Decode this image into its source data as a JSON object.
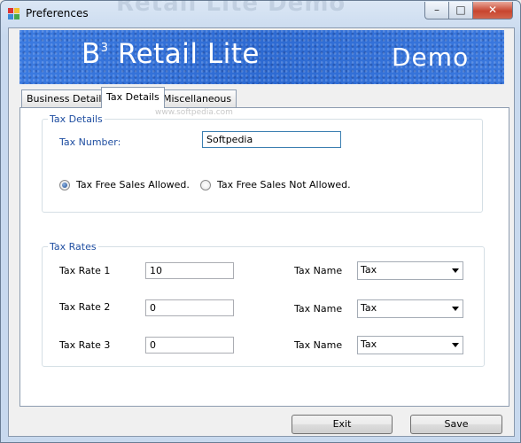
{
  "window": {
    "title": "Preferences",
    "faded_title": "Retail Lite Demo"
  },
  "banner": {
    "title": "B",
    "superscript": "3",
    "title_rest": " Retail Lite",
    "edition": "Demo"
  },
  "tabs": [
    {
      "label": "Business Details",
      "active": false
    },
    {
      "label": "Tax Details",
      "active": true
    },
    {
      "label": "Miscellaneous",
      "active": false
    }
  ],
  "watermark": "www.softpedia.com",
  "tax_details": {
    "legend": "Tax Details",
    "tax_number_label": "Tax Number:",
    "tax_number_value": "Softpedia",
    "radio_allowed": "Tax Free Sales Allowed.",
    "radio_not_allowed": "Tax Free Sales Not Allowed.",
    "selected": "allowed"
  },
  "tax_rates": {
    "legend": "Tax Rates",
    "name_label": "Tax Name",
    "rows": [
      {
        "label": "Tax Rate 1",
        "value": "10",
        "name": "Tax"
      },
      {
        "label": "Tax Rate 2",
        "value": "0",
        "name": "Tax"
      },
      {
        "label": "Tax Rate 3",
        "value": "0",
        "name": "Tax"
      }
    ]
  },
  "buttons": {
    "exit": "Exit",
    "save": "Save"
  },
  "colors": {
    "group_legend": "#1f4ea1",
    "banner": "#2f6fd6"
  }
}
